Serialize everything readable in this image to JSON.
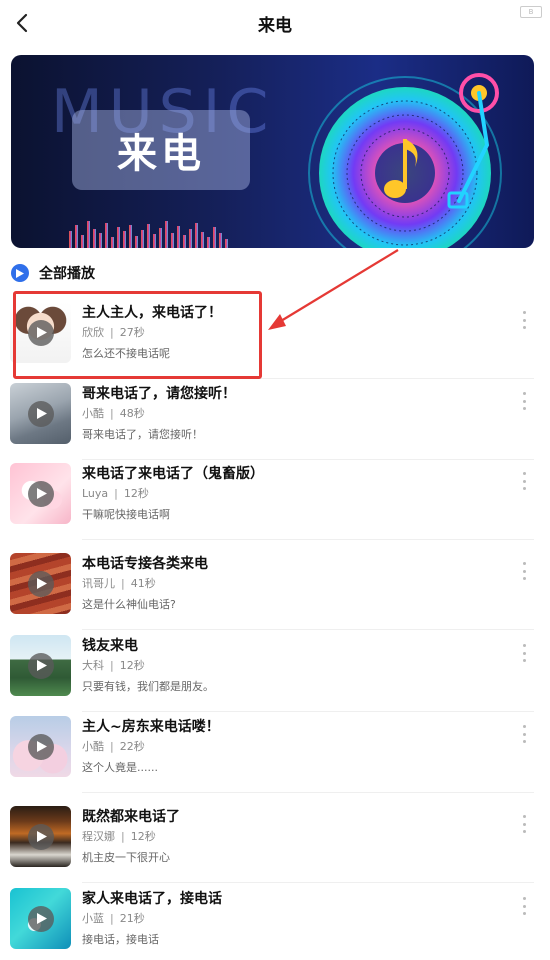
{
  "header": {
    "title": "来电",
    "corner_mark": "B"
  },
  "banner": {
    "bg_word": "MUSIC",
    "title": "来电"
  },
  "play_all": {
    "label": "全部播放"
  },
  "colors": {
    "accent": "#2f6fea",
    "highlight": "#e53935"
  },
  "songs": [
    {
      "title": "主人主人，来电话了！",
      "artist": "欣欣",
      "duration": "27秒",
      "desc": "怎么还不接电话呢",
      "thumb": "anime-girl"
    },
    {
      "title": "哥来电话了，请您接听！",
      "artist": "小酷",
      "duration": "48秒",
      "desc": "哥来电话了，请您接听！",
      "thumb": "misty-mountains"
    },
    {
      "title": "来电话了来电话了（鬼畜版）",
      "artist": "Luya",
      "duration": "12秒",
      "desc": "干嘛呢快接电话啊",
      "thumb": "pink-cartoon"
    },
    {
      "title": "本电话专接各类来电",
      "artist": "讯哥儿",
      "duration": "41秒",
      "desc": "这是什么神仙电话?",
      "thumb": "red-canyon"
    },
    {
      "title": "钱友来电",
      "artist": "大科",
      "duration": "12秒",
      "desc": "只要有钱，我们都是朋友。",
      "thumb": "pagoda"
    },
    {
      "title": "主人~房东来电话喽！",
      "artist": "小酷",
      "duration": "22秒",
      "desc": "这个人竟是......",
      "thumb": "pink-clouds"
    },
    {
      "title": "既然都来电话了",
      "artist": "程汉娜",
      "duration": "12秒",
      "desc": "机主皮一下很开心",
      "thumb": "autumn-waterfall"
    },
    {
      "title": "家人来电话了，接电话",
      "artist": "小蓝",
      "duration": "21秒",
      "desc": "接电话，接电话",
      "thumb": "turquoise-sea"
    }
  ]
}
